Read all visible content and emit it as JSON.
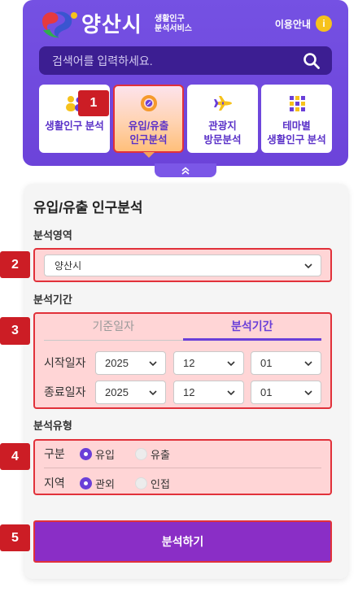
{
  "colors": {
    "brand_purple": "#6c43d9",
    "search_bg": "#3c1e92",
    "accent_purple": "#6a3fd8",
    "button_purple": "#8a2ec6",
    "guide_yellow": "#f6c21c",
    "active_orange": "#f4a15a",
    "annotation_red": "#cc1d25",
    "highlight_fill": "#ffd5d6",
    "highlight_border": "#e1313a"
  },
  "header": {
    "logo": {
      "name": "양산시",
      "sub_line1": "생활인구",
      "sub_line2": "분석서비스",
      "icon": "yangsan-logo-icon"
    },
    "guide": {
      "label": "이용안내",
      "icon_text": "i"
    },
    "search": {
      "placeholder": "검색어를 입력하세요.",
      "icon": "search-icon"
    }
  },
  "menu": [
    {
      "lines": [
        "생활인구 분석"
      ],
      "icon": "people-icon",
      "active": false
    },
    {
      "lines": [
        "유입/유출",
        "인구분석"
      ],
      "icon": "donut-chart-icon",
      "active": true
    },
    {
      "lines": [
        "관광지",
        "방문분석"
      ],
      "icon": "airplane-icon",
      "active": false
    },
    {
      "lines": [
        "테마별",
        "생활인구 분석"
      ],
      "icon": "grid-icon",
      "active": false
    }
  ],
  "collapse_toggle": {
    "icon": "double-chevron-up-icon"
  },
  "form": {
    "title": "유입/유출 인구분석",
    "area": {
      "label": "분석영역",
      "selected": "양산시"
    },
    "period": {
      "label": "분석기간",
      "tabs": [
        {
          "label": "기준일자",
          "active": false
        },
        {
          "label": "분석기간",
          "active": true
        }
      ],
      "start": {
        "label": "시작일자",
        "year": "2025",
        "month": "12",
        "day": "01"
      },
      "end": {
        "label": "종료일자",
        "year": "2025",
        "month": "12",
        "day": "01"
      }
    },
    "type": {
      "label": "분석유형",
      "rows": [
        {
          "label": "구분",
          "options": [
            {
              "label": "유입",
              "selected": true
            },
            {
              "label": "유출",
              "selected": false
            }
          ]
        },
        {
          "label": "지역",
          "options": [
            {
              "label": "관외",
              "selected": true
            },
            {
              "label": "인접",
              "selected": false
            }
          ]
        }
      ]
    },
    "submit": {
      "label": "분석하기"
    }
  },
  "annotations": [
    "1",
    "2",
    "3",
    "4",
    "5"
  ]
}
